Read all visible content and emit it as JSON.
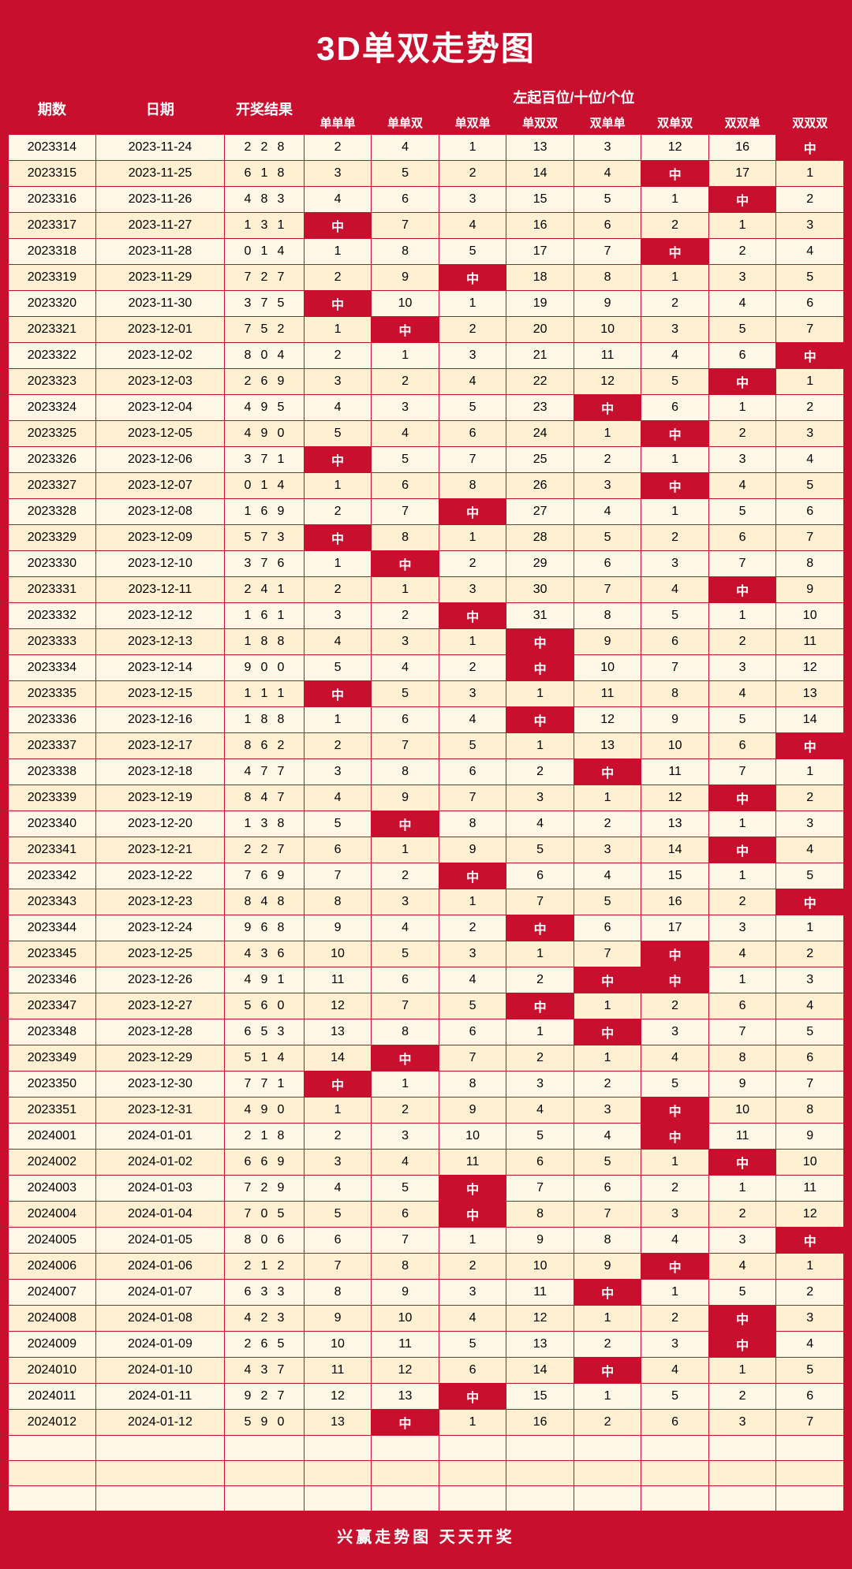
{
  "title": "3D单双走势图",
  "subtitle": "左起百位/十位/个位",
  "headers": {
    "qishu": "期数",
    "riqi": "日期",
    "kaijang": "开奖结果",
    "cols": [
      "单单单",
      "单单双",
      "单双单",
      "单双双",
      "双单单",
      "双单双",
      "双双单",
      "双双双"
    ]
  },
  "rows": [
    {
      "id": "2023314",
      "date": "2023-11-24",
      "nums": [
        2,
        2,
        8
      ],
      "vals": [
        2,
        4,
        1,
        13,
        3,
        12,
        16,
        "中"
      ]
    },
    {
      "id": "2023315",
      "date": "2023-11-25",
      "nums": [
        6,
        1,
        8
      ],
      "vals": [
        3,
        5,
        2,
        14,
        4,
        "中",
        17,
        1
      ]
    },
    {
      "id": "2023316",
      "date": "2023-11-26",
      "nums": [
        4,
        8,
        3
      ],
      "vals": [
        4,
        6,
        3,
        15,
        5,
        1,
        "中",
        2
      ]
    },
    {
      "id": "2023317",
      "date": "2023-11-27",
      "nums": [
        1,
        3,
        1
      ],
      "vals": [
        "中",
        7,
        4,
        16,
        6,
        2,
        1,
        3
      ]
    },
    {
      "id": "2023318",
      "date": "2023-11-28",
      "nums": [
        0,
        1,
        4
      ],
      "vals": [
        1,
        8,
        5,
        17,
        7,
        "中",
        2,
        4
      ]
    },
    {
      "id": "2023319",
      "date": "2023-11-29",
      "nums": [
        7,
        2,
        7
      ],
      "vals": [
        2,
        9,
        "中",
        18,
        8,
        1,
        3,
        5
      ]
    },
    {
      "id": "2023320",
      "date": "2023-11-30",
      "nums": [
        3,
        7,
        5
      ],
      "vals": [
        "中",
        10,
        1,
        19,
        9,
        2,
        4,
        6
      ]
    },
    {
      "id": "2023321",
      "date": "2023-12-01",
      "nums": [
        7,
        5,
        2
      ],
      "vals": [
        1,
        "中",
        2,
        20,
        10,
        3,
        5,
        7
      ]
    },
    {
      "id": "2023322",
      "date": "2023-12-02",
      "nums": [
        8,
        0,
        4
      ],
      "vals": [
        2,
        1,
        3,
        21,
        11,
        4,
        6,
        "中"
      ]
    },
    {
      "id": "2023323",
      "date": "2023-12-03",
      "nums": [
        2,
        6,
        9
      ],
      "vals": [
        3,
        2,
        4,
        22,
        12,
        5,
        "中",
        1
      ]
    },
    {
      "id": "2023324",
      "date": "2023-12-04",
      "nums": [
        4,
        9,
        5
      ],
      "vals": [
        4,
        3,
        5,
        23,
        "中",
        6,
        1,
        2
      ]
    },
    {
      "id": "2023325",
      "date": "2023-12-05",
      "nums": [
        4,
        9,
        0
      ],
      "vals": [
        5,
        4,
        6,
        24,
        1,
        "中",
        2,
        3
      ]
    },
    {
      "id": "2023326",
      "date": "2023-12-06",
      "nums": [
        3,
        7,
        1
      ],
      "vals": [
        "中",
        5,
        7,
        25,
        2,
        1,
        3,
        4
      ]
    },
    {
      "id": "2023327",
      "date": "2023-12-07",
      "nums": [
        0,
        1,
        4
      ],
      "vals": [
        1,
        6,
        8,
        26,
        3,
        "中",
        4,
        5
      ]
    },
    {
      "id": "2023328",
      "date": "2023-12-08",
      "nums": [
        1,
        6,
        9
      ],
      "vals": [
        2,
        7,
        "中",
        27,
        4,
        1,
        5,
        6
      ]
    },
    {
      "id": "2023329",
      "date": "2023-12-09",
      "nums": [
        5,
        7,
        3
      ],
      "vals": [
        "中",
        8,
        1,
        28,
        5,
        2,
        6,
        7
      ]
    },
    {
      "id": "2023330",
      "date": "2023-12-10",
      "nums": [
        3,
        7,
        6
      ],
      "vals": [
        1,
        "中",
        2,
        29,
        6,
        3,
        7,
        8
      ]
    },
    {
      "id": "2023331",
      "date": "2023-12-11",
      "nums": [
        2,
        4,
        1
      ],
      "vals": [
        2,
        1,
        3,
        30,
        7,
        4,
        "中",
        9
      ]
    },
    {
      "id": "2023332",
      "date": "2023-12-12",
      "nums": [
        1,
        6,
        1
      ],
      "vals": [
        3,
        2,
        "中",
        31,
        8,
        5,
        1,
        10
      ]
    },
    {
      "id": "2023333",
      "date": "2023-12-13",
      "nums": [
        1,
        8,
        8
      ],
      "vals": [
        4,
        3,
        1,
        "中",
        9,
        6,
        2,
        11
      ]
    },
    {
      "id": "2023334",
      "date": "2023-12-14",
      "nums": [
        9,
        0,
        0
      ],
      "vals": [
        5,
        4,
        2,
        "中",
        10,
        7,
        3,
        12
      ]
    },
    {
      "id": "2023335",
      "date": "2023-12-15",
      "nums": [
        1,
        1,
        1
      ],
      "vals": [
        "中",
        5,
        3,
        1,
        11,
        8,
        4,
        13
      ]
    },
    {
      "id": "2023336",
      "date": "2023-12-16",
      "nums": [
        1,
        8,
        8
      ],
      "vals": [
        1,
        6,
        4,
        "中",
        12,
        9,
        5,
        14
      ]
    },
    {
      "id": "2023337",
      "date": "2023-12-17",
      "nums": [
        8,
        6,
        2
      ],
      "vals": [
        2,
        7,
        5,
        1,
        13,
        10,
        6,
        "中"
      ]
    },
    {
      "id": "2023338",
      "date": "2023-12-18",
      "nums": [
        4,
        7,
        7
      ],
      "vals": [
        3,
        8,
        6,
        2,
        "中",
        11,
        7,
        1
      ]
    },
    {
      "id": "2023339",
      "date": "2023-12-19",
      "nums": [
        8,
        4,
        7
      ],
      "vals": [
        4,
        9,
        7,
        3,
        1,
        12,
        "中",
        2
      ]
    },
    {
      "id": "2023340",
      "date": "2023-12-20",
      "nums": [
        1,
        3,
        8
      ],
      "vals": [
        5,
        "中",
        8,
        4,
        2,
        13,
        1,
        3
      ]
    },
    {
      "id": "2023341",
      "date": "2023-12-21",
      "nums": [
        2,
        2,
        7
      ],
      "vals": [
        6,
        1,
        9,
        5,
        3,
        14,
        "中",
        4
      ]
    },
    {
      "id": "2023342",
      "date": "2023-12-22",
      "nums": [
        7,
        6,
        9
      ],
      "vals": [
        7,
        2,
        "中",
        6,
        4,
        15,
        1,
        5
      ]
    },
    {
      "id": "2023343",
      "date": "2023-12-23",
      "nums": [
        8,
        4,
        8
      ],
      "vals": [
        8,
        3,
        1,
        7,
        5,
        16,
        2,
        "中"
      ]
    },
    {
      "id": "2023344",
      "date": "2023-12-24",
      "nums": [
        9,
        6,
        8
      ],
      "vals": [
        9,
        4,
        2,
        "中",
        6,
        17,
        3,
        1
      ]
    },
    {
      "id": "2023345",
      "date": "2023-12-25",
      "nums": [
        4,
        3,
        6
      ],
      "vals": [
        10,
        5,
        3,
        1,
        7,
        "中",
        4,
        2
      ]
    },
    {
      "id": "2023346",
      "date": "2023-12-26",
      "nums": [
        4,
        9,
        1
      ],
      "vals": [
        11,
        6,
        4,
        2,
        "中",
        "中",
        1,
        3
      ]
    },
    {
      "id": "2023347",
      "date": "2023-12-27",
      "nums": [
        5,
        6,
        0
      ],
      "vals": [
        12,
        7,
        5,
        "中",
        1,
        2,
        6,
        4
      ]
    },
    {
      "id": "2023348",
      "date": "2023-12-28",
      "nums": [
        6,
        5,
        3
      ],
      "vals": [
        13,
        8,
        6,
        1,
        "中",
        3,
        7,
        5
      ]
    },
    {
      "id": "2023349",
      "date": "2023-12-29",
      "nums": [
        5,
        1,
        4
      ],
      "vals": [
        14,
        "中",
        7,
        2,
        1,
        4,
        8,
        6
      ]
    },
    {
      "id": "2023350",
      "date": "2023-12-30",
      "nums": [
        7,
        7,
        1
      ],
      "vals": [
        "中",
        1,
        8,
        3,
        2,
        5,
        9,
        7
      ]
    },
    {
      "id": "2023351",
      "date": "2023-12-31",
      "nums": [
        4,
        9,
        0
      ],
      "vals": [
        1,
        2,
        9,
        4,
        3,
        "中",
        10,
        8
      ]
    },
    {
      "id": "2024001",
      "date": "2024-01-01",
      "nums": [
        2,
        1,
        8
      ],
      "vals": [
        2,
        3,
        10,
        5,
        4,
        "中",
        11,
        9
      ]
    },
    {
      "id": "2024002",
      "date": "2024-01-02",
      "nums": [
        6,
        6,
        9
      ],
      "vals": [
        3,
        4,
        11,
        6,
        5,
        1,
        "中",
        10
      ]
    },
    {
      "id": "2024003",
      "date": "2024-01-03",
      "nums": [
        7,
        2,
        9
      ],
      "vals": [
        4,
        5,
        "中",
        7,
        6,
        2,
        1,
        11
      ]
    },
    {
      "id": "2024004",
      "date": "2024-01-04",
      "nums": [
        7,
        0,
        5
      ],
      "vals": [
        5,
        6,
        "中",
        8,
        7,
        3,
        2,
        12
      ]
    },
    {
      "id": "2024005",
      "date": "2024-01-05",
      "nums": [
        8,
        0,
        6
      ],
      "vals": [
        6,
        7,
        1,
        9,
        8,
        4,
        3,
        "中"
      ]
    },
    {
      "id": "2024006",
      "date": "2024-01-06",
      "nums": [
        2,
        1,
        2
      ],
      "vals": [
        7,
        8,
        2,
        10,
        9,
        "中",
        4,
        1
      ]
    },
    {
      "id": "2024007",
      "date": "2024-01-07",
      "nums": [
        6,
        3,
        3
      ],
      "vals": [
        8,
        9,
        3,
        11,
        "中",
        1,
        5,
        2
      ]
    },
    {
      "id": "2024008",
      "date": "2024-01-08",
      "nums": [
        4,
        2,
        3
      ],
      "vals": [
        9,
        10,
        4,
        12,
        1,
        2,
        "中",
        3
      ]
    },
    {
      "id": "2024009",
      "date": "2024-01-09",
      "nums": [
        2,
        6,
        5
      ],
      "vals": [
        10,
        11,
        5,
        13,
        2,
        3,
        "中",
        4
      ]
    },
    {
      "id": "2024010",
      "date": "2024-01-10",
      "nums": [
        4,
        3,
        7
      ],
      "vals": [
        11,
        12,
        6,
        14,
        "中",
        4,
        1,
        5
      ]
    },
    {
      "id": "2024011",
      "date": "2024-01-11",
      "nums": [
        9,
        2,
        7
      ],
      "vals": [
        12,
        13,
        "中",
        15,
        1,
        5,
        2,
        6
      ]
    },
    {
      "id": "2024012",
      "date": "2024-01-12",
      "nums": [
        5,
        9,
        0
      ],
      "vals": [
        13,
        "中",
        1,
        16,
        2,
        6,
        3,
        7
      ]
    }
  ],
  "footer": "兴赢走势图   天天开奖"
}
